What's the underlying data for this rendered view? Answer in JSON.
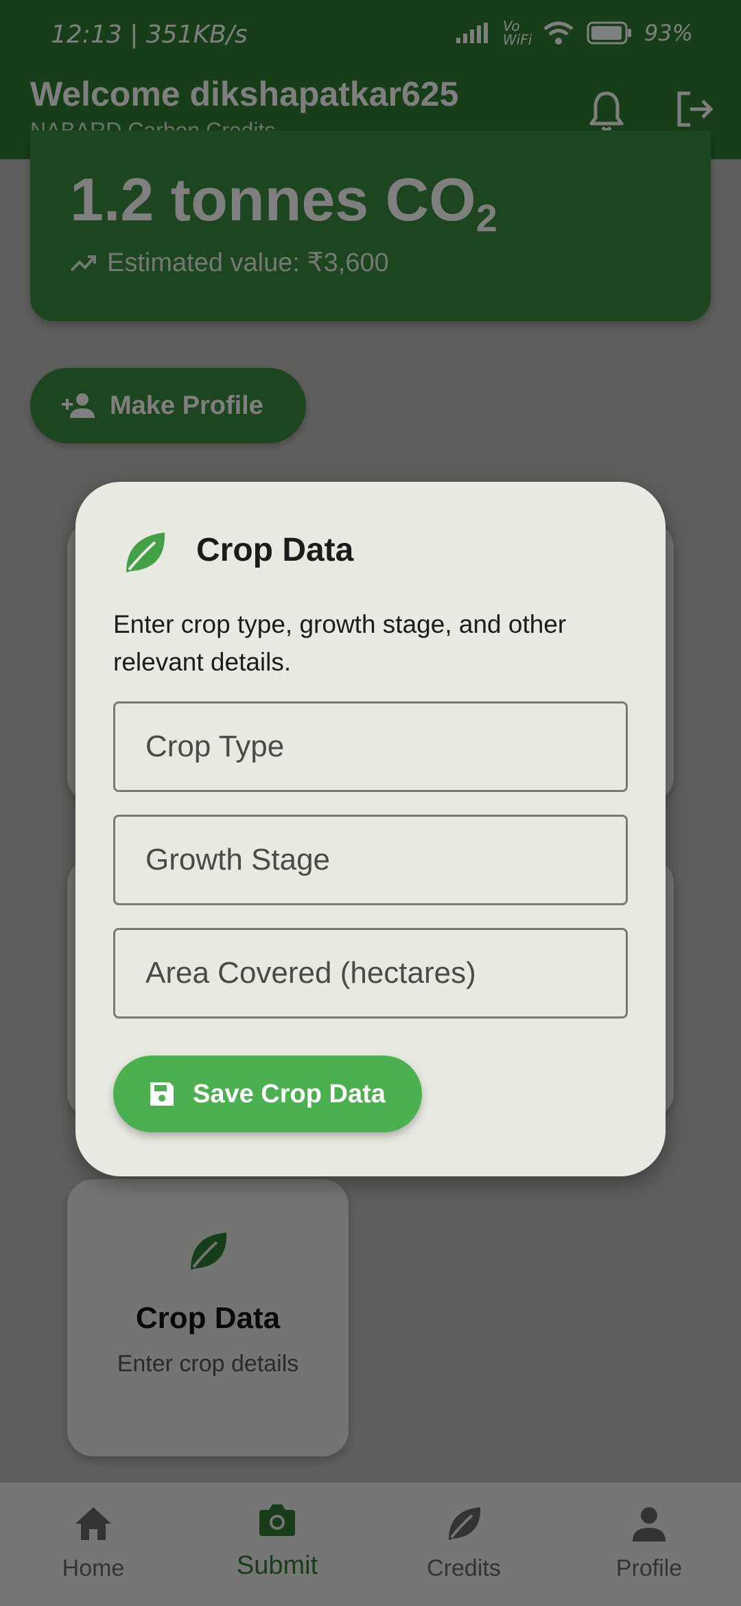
{
  "status_bar": {
    "time_and_speed": "12:13 | 351KB/s",
    "icons_text": "Vo WiFi",
    "battery": "93%"
  },
  "app_bar": {
    "title": "Welcome dikshapatkar625",
    "subtitle": "NABARD Carbon Credits",
    "icons": [
      "bell-icon",
      "logout-icon"
    ]
  },
  "credit_card": {
    "amount": "1.2 tonnes CO",
    "amount_sub": "2",
    "estimate": "Estimated value: ₹3,600"
  },
  "make_profile_label": "Make Profile",
  "bg_card": {
    "title": "Crop Data",
    "subtitle": "Enter crop details"
  },
  "dialog": {
    "title": "Crop Data",
    "description": "Enter crop type, growth stage, and other relevant details.",
    "fields": [
      {
        "placeholder": "Crop Type",
        "value": ""
      },
      {
        "placeholder": "Growth Stage",
        "value": ""
      },
      {
        "placeholder": "Area Covered (hectares)",
        "value": ""
      }
    ],
    "save_label": "Save Crop Data"
  },
  "bottom_nav": [
    {
      "label": "Home",
      "icon": "home-icon",
      "active": false
    },
    {
      "label": "Submit",
      "icon": "camera-icon",
      "active": true
    },
    {
      "label": "Credits",
      "icon": "leaf-icon",
      "active": false
    },
    {
      "label": "Profile",
      "icon": "person-icon",
      "active": false
    }
  ],
  "colors": {
    "primary": "#2e7d32",
    "button": "#4caf50",
    "dialog_bg": "#e8eae2"
  }
}
